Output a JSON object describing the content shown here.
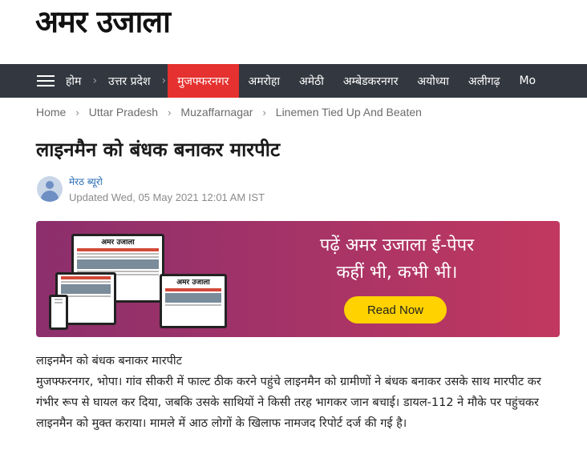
{
  "site": {
    "logo_text": "अमर उजाला"
  },
  "nav": {
    "items": [
      {
        "label": "होम",
        "active": false
      },
      {
        "label": "उत्तर प्रदेश",
        "active": false
      },
      {
        "label": "मुजफ्फरनगर",
        "active": true
      },
      {
        "label": "अमरोहा",
        "active": false
      },
      {
        "label": "अमेठी",
        "active": false
      },
      {
        "label": "अम्बेडकरनगर",
        "active": false
      },
      {
        "label": "अयोध्या",
        "active": false
      },
      {
        "label": "अलीगढ़",
        "active": false
      },
      {
        "label": "Mo",
        "active": false
      }
    ]
  },
  "breadcrumb": [
    "Home",
    "Uttar Pradesh",
    "Muzaffarnagar",
    "Linemen Tied Up And Beaten"
  ],
  "article": {
    "title": "लाइनमैन को बंधक बनाकर मारपीट",
    "author": "मेरठ ब्यूरो",
    "updated": "Updated Wed, 05 May 2021 12:01 AM IST",
    "subhead": "लाइनमैन को बंधक बनाकर मारपीट",
    "body": "मुजफ्फरनगर, भोपा। गांव सीकरी में फाल्ट ठीक करने पहुंचे लाइनमैन को ग्रामीणों ने बंधक बनाकर उसके साथ मारपीट कर गंभीर रूप से घायल कर दिया, जबकि उसके साथियों ने किसी तरह भागकर जान बचाई। डायल-112 ने मौके पर पहुंचकर लाइनमैन को मुक्त कराया। मामले में आठ लोगों के खिलाफ नामजद रिपोर्ट दर्ज की गई है।"
  },
  "banner": {
    "line1": "पढ़ें अमर उजाला ई-पेपर",
    "line2": "कहीं भी, कभी भी।",
    "button": "Read Now",
    "device_masthead": "अमर उजाला",
    "colors": {
      "gradient_start": "#8c2f6c",
      "gradient_end": "#c2385f",
      "button": "#ffd200"
    }
  },
  "colors": {
    "nav_bg": "#333840",
    "nav_active": "#e5312f",
    "link": "#2a6db5"
  }
}
